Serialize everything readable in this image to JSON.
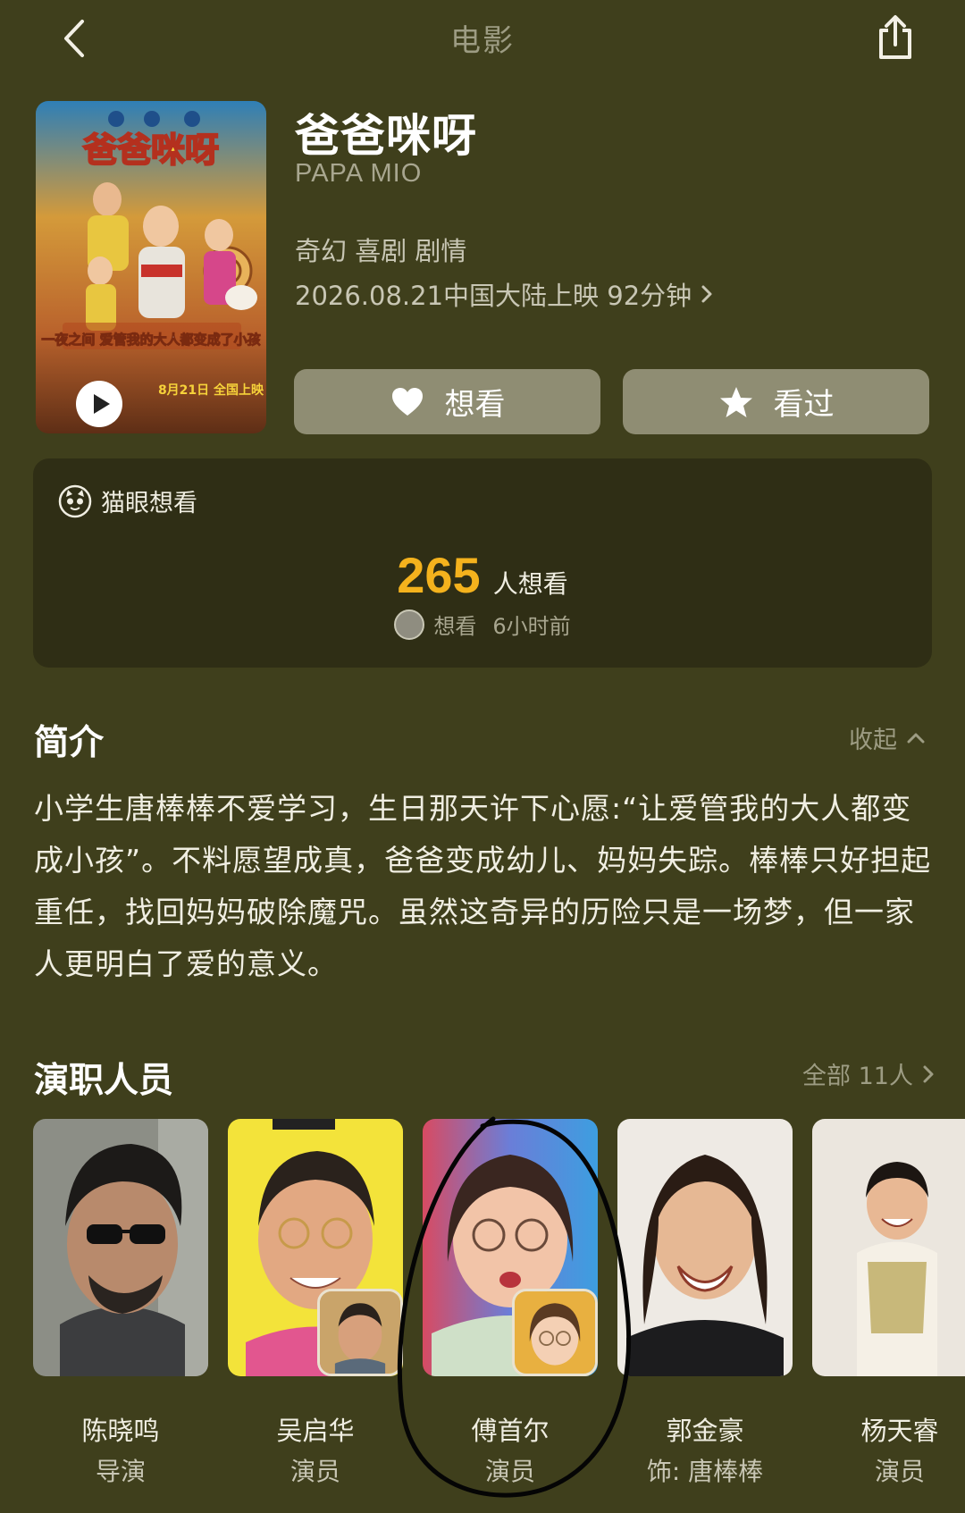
{
  "header": {
    "title": "电影"
  },
  "movie": {
    "title": "爸爸咪呀",
    "subtitle": "PAPA MIO",
    "genres": "奇幻 喜剧 剧情",
    "release": "2026.08.21中国大陆上映 92分钟",
    "poster": {
      "title": "爸爸咪呀",
      "tagline": "一夜之间 爱管我的大人都变成了小孩",
      "date": "8月21日 全国上映"
    }
  },
  "actions": {
    "want": "想看",
    "seen": "看过"
  },
  "maoyan": {
    "label": "猫眼想看",
    "count": "265",
    "count_unit": "人想看",
    "recent_label": "想看",
    "recent_time": "6小时前"
  },
  "intro": {
    "title": "简介",
    "collapse": "收起",
    "text": "小学生唐棒棒不爱学习，生日那天许下心愿:“让爱管我的大人都变成小孩”。不料愿望成真，爸爸变成幼儿、妈妈失踪。棒棒只好担起重任，找回妈妈破除魔咒。虽然这奇异的历险只是一场梦，但一家人更明白了爱的意义。"
  },
  "cast": {
    "title": "演职人员",
    "all": "全部 11人",
    "members": [
      {
        "name": "陈晓鸣",
        "role": "导演"
      },
      {
        "name": "吴启华",
        "role": "演员"
      },
      {
        "name": "傅首尔",
        "role": "演员"
      },
      {
        "name": "郭金豪",
        "role": "饰: 唐棒棒"
      },
      {
        "name": "杨天睿",
        "role": "演员"
      }
    ]
  },
  "colors": {
    "background": "#3f3f1c",
    "card": "#2f2e15",
    "button": "#8f8d73",
    "accent": "#f4b21d"
  }
}
